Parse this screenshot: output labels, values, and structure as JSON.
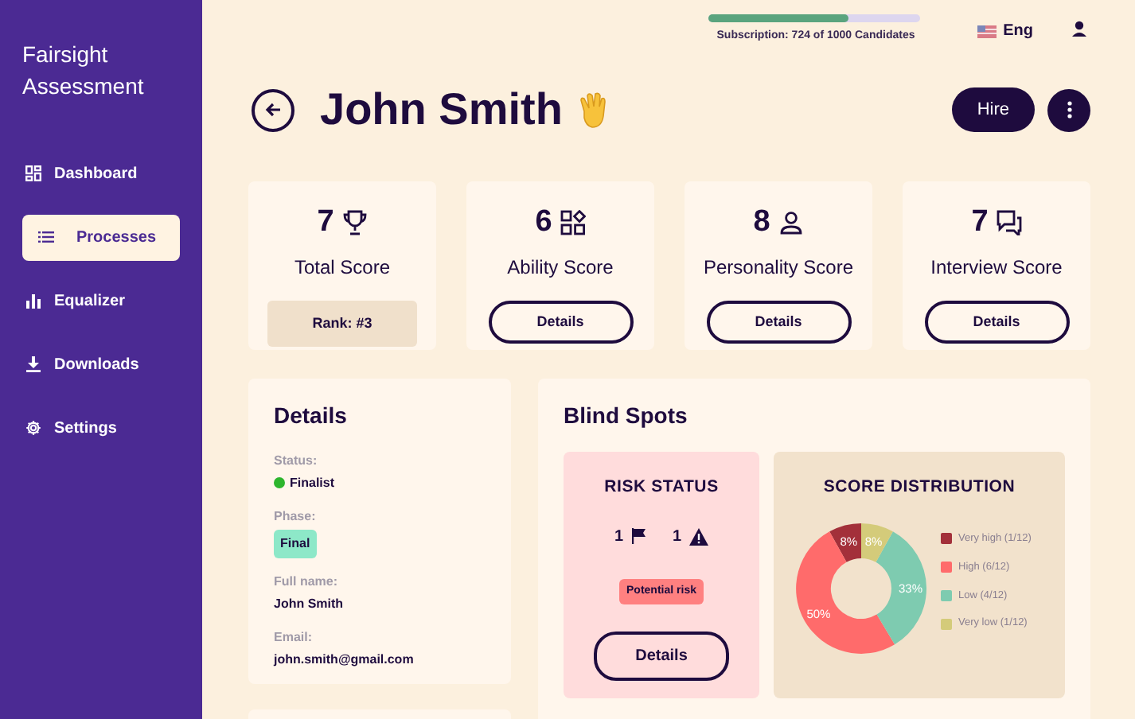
{
  "sidebar": {
    "title": "Fairsight Assessment",
    "items": [
      {
        "label": "Dashboard",
        "selected": false
      },
      {
        "label": "Processes",
        "selected": true
      },
      {
        "label": "Equalizer",
        "selected": false
      },
      {
        "label": "Downloads",
        "selected": false
      },
      {
        "label": "Settings",
        "selected": false
      }
    ]
  },
  "subscription": {
    "text": "Subscription: 724 of 1000 Candidates",
    "level": 0.66
  },
  "language": "Eng",
  "candidate": {
    "name": "John Smith"
  },
  "hire_button": "Hire",
  "score_cards": [
    {
      "kind": "rank",
      "score": "7",
      "label": "Total Score",
      "rank": "Rank: #3"
    },
    {
      "kind": "details",
      "score": "6",
      "label": "Ability Score",
      "button": "Details"
    },
    {
      "kind": "details",
      "score": "8",
      "label": "Personality Score",
      "button": "Details"
    },
    {
      "kind": "details",
      "score": "7",
      "label": "Interview Score",
      "button": "Details"
    }
  ],
  "details": {
    "title": "Details",
    "fields": [
      {
        "kind": "status",
        "label": "Status:",
        "value": "Finalist"
      },
      {
        "kind": "tag",
        "label": "Phase:",
        "value": "Final"
      },
      {
        "kind": "text",
        "label": "Full name:",
        "value": "John Smith"
      },
      {
        "kind": "text",
        "label": "Email:",
        "value": "john.smith@gmail.com"
      }
    ]
  },
  "blind_spots": {
    "title": "Blind Spots",
    "risk_status": {
      "title": "RISK STATUS",
      "flags": "1",
      "warnings": "1",
      "tag": "Potential risk",
      "button": "Details"
    },
    "score_distribution": {
      "title": "SCORE DISTRIBUTION",
      "chart_data": {
        "type": "donut",
        "categories": [
          "Very high (1/12)",
          "High (6/12)",
          "Low (4/12)",
          "Very low (1/12)"
        ],
        "values": [
          8,
          50,
          33,
          8
        ],
        "legend": "right",
        "value_labels": [
          "8%",
          "50%",
          "33%",
          "8%"
        ]
      }
    }
  }
}
